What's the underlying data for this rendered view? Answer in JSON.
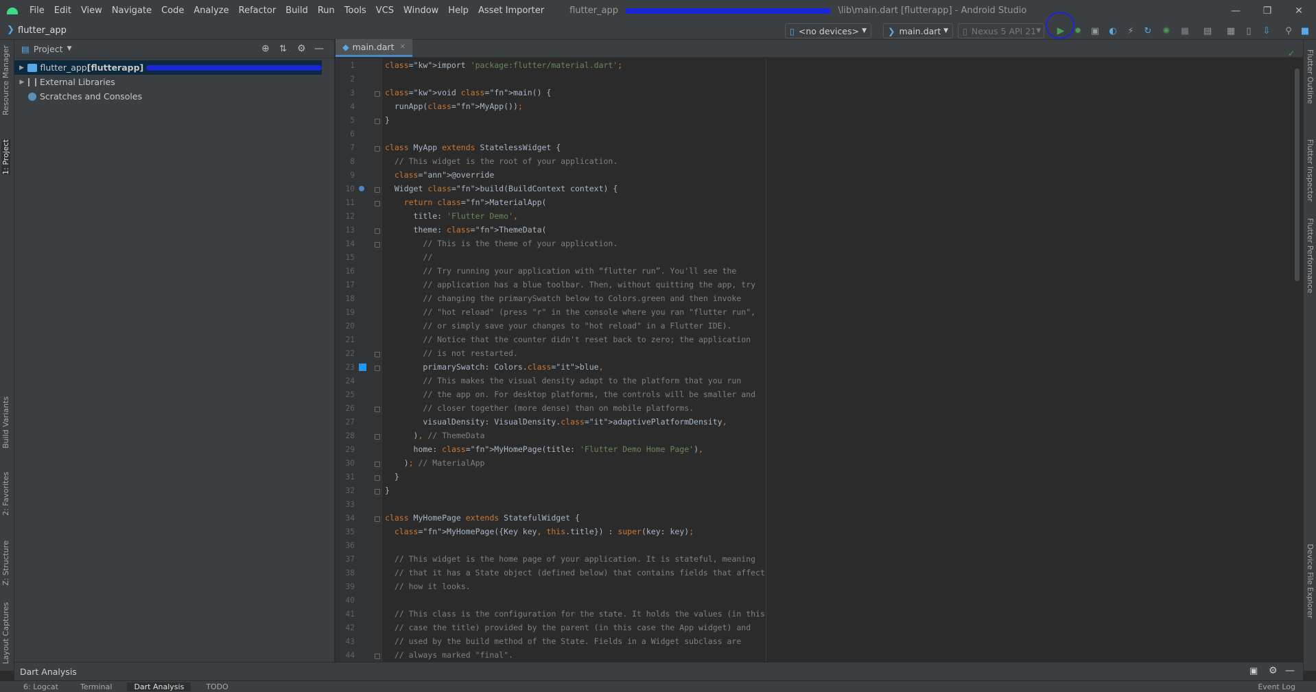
{
  "titlebar": {
    "menus": [
      "File",
      "Edit",
      "View",
      "Navigate",
      "Code",
      "Analyze",
      "Refactor",
      "Build",
      "Run",
      "Tools",
      "VCS",
      "Window",
      "Help",
      "Asset Importer"
    ],
    "title_prefix": "flutter_app",
    "title_suffix": "\\lib\\main.dart [flutterapp] - Android Studio"
  },
  "navbar": {
    "project_name": "flutter_app",
    "device_combo": "<no devices>",
    "config_combo": "main.dart",
    "avd_combo": "Nexus 5 API 21"
  },
  "colors": {
    "run_green": "#499c54",
    "accent_blue": "#4a88c7",
    "annotation_circle": "#1a25d6"
  },
  "left_tabs": [
    "Resource Manager",
    "1: Project",
    "Build Variants",
    "2: Favorites",
    "Z: Structure",
    "Layout Captures"
  ],
  "right_tabs": [
    "Flutter Outline",
    "Flutter Inspector",
    "Flutter Performance",
    "Device File Explorer"
  ],
  "project_panel": {
    "view_selector": "Project",
    "tree": [
      {
        "name": "flutter_app",
        "suffix": " [flutterapp]",
        "selected": true
      },
      {
        "name": "External Libraries"
      },
      {
        "name": "Scratches and Consoles"
      }
    ]
  },
  "editor": {
    "tab": "main.dart",
    "line_count": 44,
    "lines": [
      "import 'package:flutter/material.dart';",
      "",
      "void main() {",
      "  runApp(MyApp());",
      "}",
      "",
      "class MyApp extends StatelessWidget {",
      "  // This widget is the root of your application.",
      "  @override",
      "  Widget build(BuildContext context) {",
      "    return MaterialApp(",
      "      title: 'Flutter Demo',",
      "      theme: ThemeData(",
      "        // This is the theme of your application.",
      "        //",
      "        // Try running your application with “flutter run”. You'll see the",
      "        // application has a blue toolbar. Then, without quitting the app, try",
      "        // changing the primarySwatch below to Colors.green and then invoke",
      "        // \"hot reload\" (press \"r\" in the console where you ran \"flutter run\",",
      "        // or simply save your changes to \"hot reload\" in a Flutter IDE).",
      "        // Notice that the counter didn't reset back to zero; the application",
      "        // is not restarted.",
      "        primarySwatch: Colors.blue,",
      "        // This makes the visual density adapt to the platform that you run",
      "        // the app on. For desktop platforms, the controls will be smaller and",
      "        // closer together (more dense) than on mobile platforms.",
      "        visualDensity: VisualDensity.adaptivePlatformDensity,",
      "      ), // ThemeData",
      "      home: MyHomePage(title: 'Flutter Demo Home Page'),",
      "    ); // MaterialApp",
      "  }",
      "}",
      "",
      "class MyHomePage extends StatefulWidget {",
      "  MyHomePage({Key key, this.title}) : super(key: key);",
      "",
      "  // This widget is the home page of your application. It is stateful, meaning",
      "  // that it has a State object (defined below) that contains fields that affect",
      "  // how it looks.",
      "",
      "  // This class is the configuration for the state. It holds the values (in this",
      "  // case the title) provided by the parent (in this case the App widget) and",
      "  // used by the build method of the State. Fields in a Widget subclass are",
      "  // always marked \"final\"."
    ]
  },
  "bottom_panel": {
    "title": "Dart Analysis"
  },
  "status_tabs": [
    "6: Logcat",
    "Terminal",
    "Dart Analysis",
    "TODO",
    "Event Log"
  ]
}
